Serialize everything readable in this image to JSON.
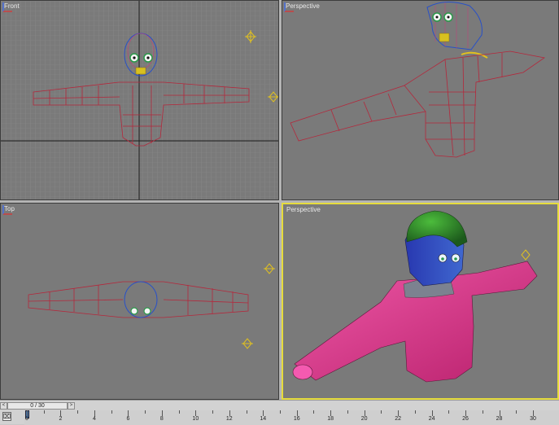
{
  "viewports": {
    "top_left": {
      "label": "Front"
    },
    "top_right": {
      "label": "Perspective"
    },
    "bottom_left": {
      "label": "Top"
    },
    "bottom_right": {
      "label": "Perspective"
    }
  },
  "timeline": {
    "slider_label": "0 / 30",
    "prev_symbol": "<",
    "next_symbol": ">",
    "track_icon_symbol": "⌧",
    "frame_labels": [
      "0",
      "2",
      "4",
      "6",
      "8",
      "10",
      "12",
      "14",
      "16",
      "18",
      "20",
      "22",
      "24",
      "26",
      "28",
      "30"
    ],
    "current_frame": 0,
    "total_frames": 30
  },
  "colors": {
    "viewport_bg": "#7a7a7a",
    "active_border": "#e6dc3c",
    "wire_red": "#b4283c",
    "wire_blue": "#2850c8",
    "skin_pink": "#e0408c",
    "hair_green": "#2e8a2e"
  }
}
